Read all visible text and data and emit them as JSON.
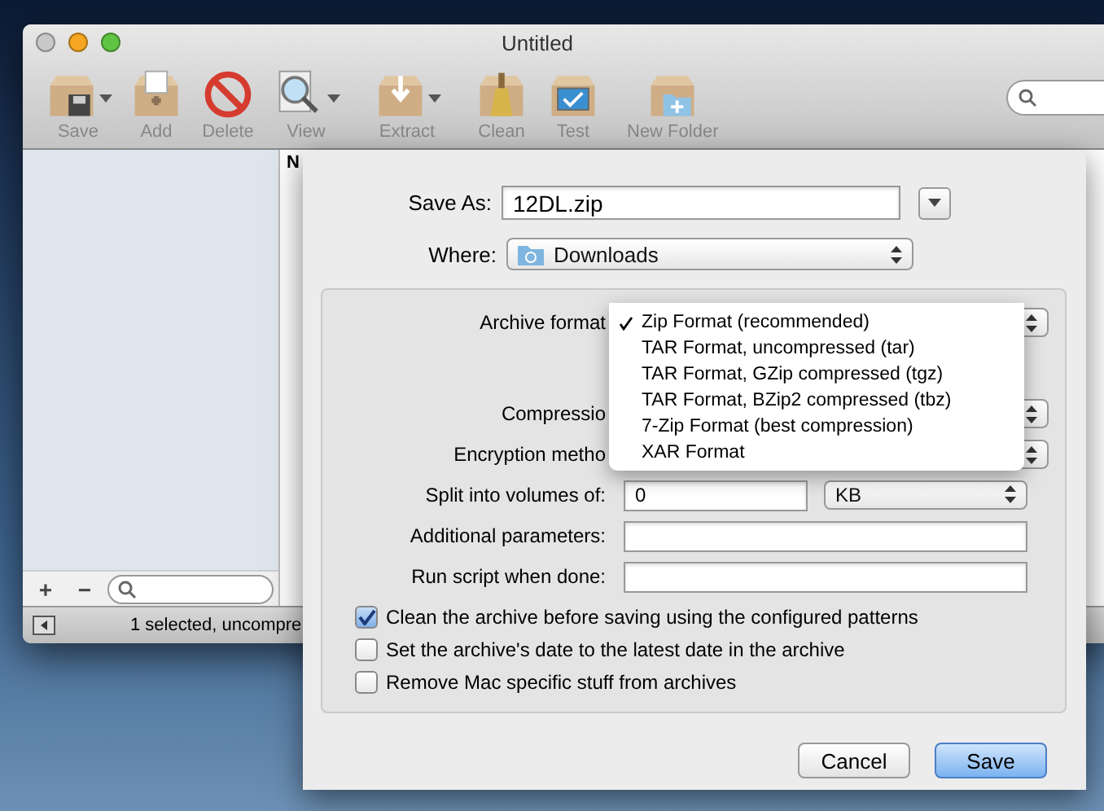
{
  "window": {
    "title": "Untitled"
  },
  "toolbar": [
    {
      "label": "Save",
      "kind": "save",
      "has_menu": true
    },
    {
      "label": "Add",
      "kind": "add",
      "has_menu": false
    },
    {
      "label": "Delete",
      "kind": "delete",
      "has_menu": false
    },
    {
      "label": "View",
      "kind": "view",
      "has_menu": true
    },
    {
      "label": "Extract",
      "kind": "extract",
      "has_menu": true
    },
    {
      "label": "Clean",
      "kind": "clean",
      "has_menu": false
    },
    {
      "label": "Test",
      "kind": "test",
      "has_menu": false
    },
    {
      "label": "New Folder",
      "kind": "folder",
      "has_menu": false
    }
  ],
  "list": {
    "column_1": "N"
  },
  "sidebar": {
    "add": "+",
    "remove": "−"
  },
  "status_bar": "1 selected, uncompre",
  "sheet": {
    "save_as": {
      "label": "Save As:",
      "value": "12DL.zip"
    },
    "where": {
      "label": "Where:",
      "value": "Downloads"
    },
    "options": [
      {
        "kind": "popup",
        "label": "Archive format"
      },
      {
        "kind": "spacer"
      },
      {
        "kind": "popup",
        "label": "Compressio"
      },
      {
        "kind": "popup",
        "label": "Encryption metho"
      },
      {
        "kind": "split",
        "label": "Split into volumes of:",
        "value": "0",
        "unit": "KB"
      },
      {
        "kind": "text",
        "label": "Additional parameters:"
      },
      {
        "kind": "text",
        "label": "Run script when done:"
      }
    ],
    "format_menu": [
      {
        "label": "Zip Format (recommended)",
        "selected": true
      },
      {
        "label": "TAR Format, uncompressed (tar)",
        "selected": false
      },
      {
        "label": "TAR Format, GZip compressed (tgz)",
        "selected": false
      },
      {
        "label": "TAR Format, BZip2 compressed (tbz)",
        "selected": false
      },
      {
        "label": "7-Zip Format (best compression)",
        "selected": false
      },
      {
        "label": "XAR Format",
        "selected": false
      }
    ],
    "checkboxes": [
      {
        "label": "Clean the archive before saving using the configured patterns",
        "checked": true
      },
      {
        "label": "Set the archive's date to the latest date in the archive",
        "checked": false
      },
      {
        "label": "Remove Mac specific stuff from archives",
        "checked": false
      }
    ],
    "buttons": [
      {
        "label": "Cancel",
        "kind": "cancel"
      },
      {
        "label": "Save",
        "kind": "default"
      }
    ]
  }
}
